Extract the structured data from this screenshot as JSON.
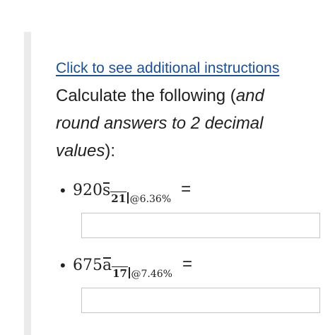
{
  "instructions_link": "Click to see additional instructions",
  "prompt": {
    "prefix": "Calculate the following (",
    "emphasis": "and round answers to 2 decimal values",
    "suffix": "):"
  },
  "questions": [
    {
      "bullet": "•",
      "coefficient": "920",
      "symbol": "s̄",
      "symbol_base": "s",
      "n": "21",
      "rate": "@6.36%",
      "equals": "=",
      "answer_value": ""
    },
    {
      "bullet": "•",
      "coefficient": "675",
      "symbol": "ā",
      "symbol_base": "a",
      "n": "17",
      "rate": "@7.46%",
      "equals": "=",
      "answer_value": ""
    }
  ]
}
